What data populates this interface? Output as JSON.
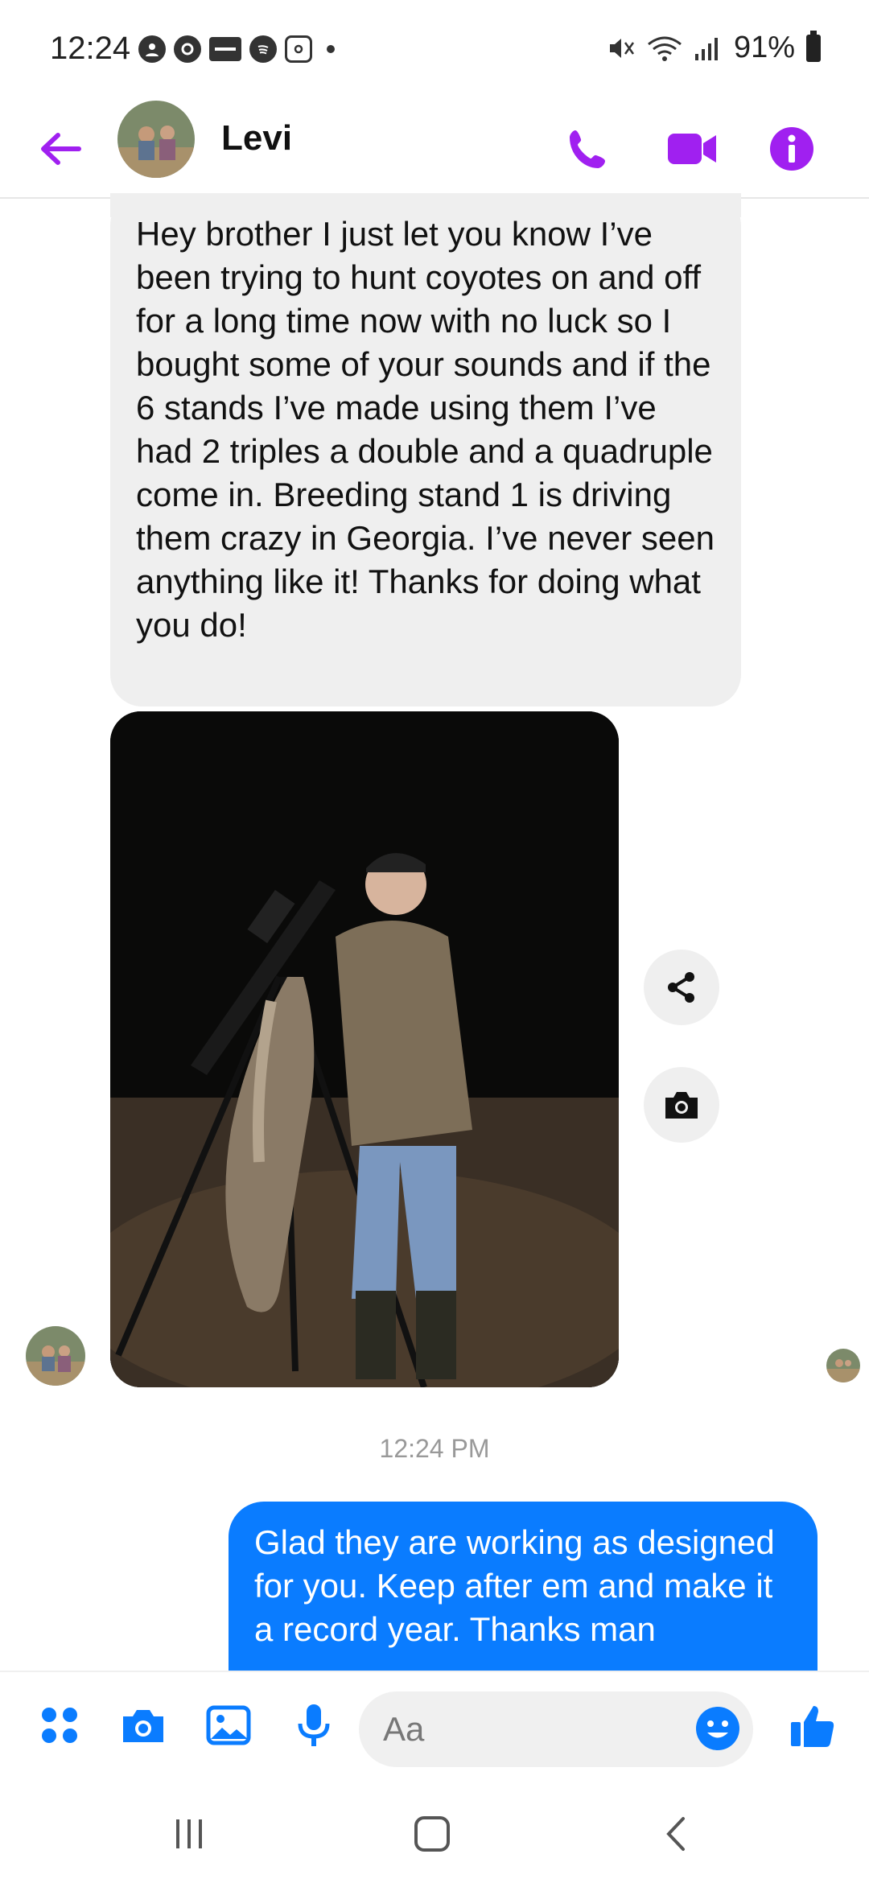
{
  "status_bar": {
    "time": "12:24",
    "battery": "91%"
  },
  "header": {
    "contact_name": "Levi"
  },
  "messages": {
    "incoming_text": "Hey brother I just let you know I’ve been trying to hunt coyotes on and off for a long time now with no luck so I bought some of your sounds and if the 6 stands I’ve made using them I’ve had 2 triples a double and a quadruple come in. Breeding stand 1 is driving them crazy in Georgia. I’ve never seen anything like it! Thanks for doing what you do!",
    "timestamp": "12:24 PM",
    "outgoing_text": "Glad they are working as designed for you. Keep after em and make it a record year. Thanks man"
  },
  "composer": {
    "placeholder": "Aa"
  },
  "colors": {
    "accent_purple": "#a020f0",
    "messenger_blue": "#0a7cff",
    "bubble_gray": "#efefef"
  },
  "icons": {
    "status_left": [
      "account-icon",
      "sync-icon",
      "ebay-icon",
      "spotify-icon",
      "instagram-icon"
    ],
    "status_right": [
      "mute-icon",
      "wifi-icon",
      "signal-icon",
      "battery-icon"
    ],
    "header": [
      "back-arrow-icon",
      "phone-icon",
      "video-icon",
      "info-icon"
    ],
    "composer": [
      "apps-icon",
      "camera-icon",
      "gallery-icon",
      "microphone-icon",
      "emoji-icon",
      "thumbs-up-icon"
    ],
    "navbar": [
      "recent-apps-icon",
      "home-icon",
      "back-icon"
    ]
  }
}
